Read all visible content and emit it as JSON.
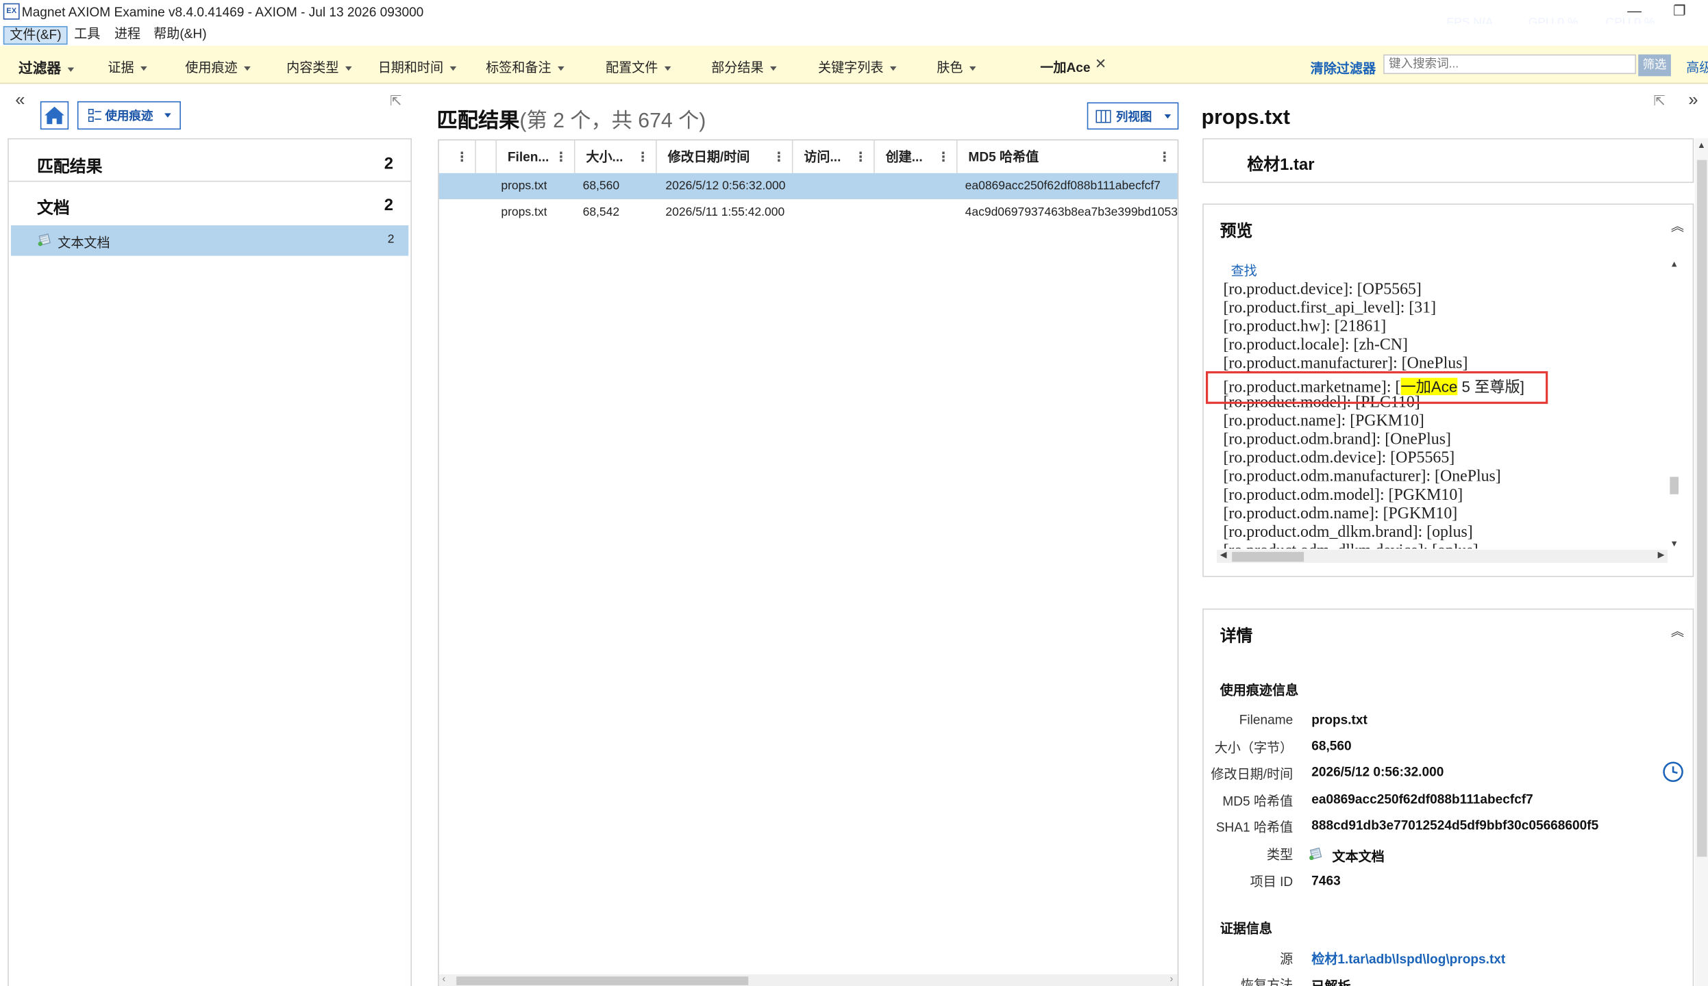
{
  "window": {
    "title": "Magnet AXIOM Examine v8.4.0.41469 - AXIOM - Jul 13 2026 093000",
    "app_icon": "EX",
    "fps_label": "FPS N/A",
    "gpu_label": "GPU 0 %",
    "cpu_label": "CPU 0 %",
    "minimize": "—",
    "restore": "❐"
  },
  "menu": {
    "items": [
      {
        "label": "文件(&F)"
      },
      {
        "label": "工具"
      },
      {
        "label": "进程"
      },
      {
        "label": "帮助(&H)"
      }
    ]
  },
  "filters": {
    "label": "过滤器",
    "items": [
      {
        "label": "证据"
      },
      {
        "label": "使用痕迹"
      },
      {
        "label": "内容类型"
      },
      {
        "label": "日期和时间"
      },
      {
        "label": "标签和备注"
      },
      {
        "label": "配置文件"
      },
      {
        "label": "部分结果"
      },
      {
        "label": "关键字列表"
      },
      {
        "label": "肤色"
      }
    ],
    "active_filter": "一加Ace",
    "clear_label": "清除过滤器",
    "search_placeholder": "键入搜索词...",
    "filter_button": "筛选",
    "advanced_label": "高级"
  },
  "left_panel": {
    "view_button": "使用痕迹",
    "rows": [
      {
        "label": "匹配结果",
        "count": "2"
      },
      {
        "label": "文档",
        "count": "2"
      },
      {
        "label": "文本文档",
        "count": "2"
      }
    ]
  },
  "results": {
    "title": "匹配结果",
    "subtitle": "(第 2 个，共 674 个)",
    "view_button": "列视图",
    "columns": [
      "Filen...",
      "大小...",
      "修改日期/时间",
      "访问...",
      "创建...",
      "MD5 哈希值"
    ],
    "rows": [
      {
        "filename": "props.txt",
        "size": "68,560",
        "modified": "2026/5/12 0:56:32.000",
        "accessed": "",
        "created": "",
        "md5": "ea0869acc250f62df088b111abecfcf7"
      },
      {
        "filename": "props.txt",
        "size": "68,542",
        "modified": "2026/5/11 1:55:42.000",
        "accessed": "",
        "created": "",
        "md5": "4ac9d0697937463b8ea7b3e399bd1053"
      }
    ]
  },
  "detail_panel": {
    "title": "props.txt",
    "evidence": "检材1.tar",
    "preview_heading": "预览",
    "find_link": "查找",
    "preview_lines": [
      "[ro.product.device]: [OP5565]",
      "[ro.product.first_api_level]: [31]",
      "[ro.product.hw]: [21861]",
      "[ro.product.locale]: [zh-CN]",
      "[ro.product.manufacturer]: [OnePlus]",
      "[ro.product.model]: [PLC110]",
      "[ro.product.name]: [PGKM10]",
      "[ro.product.odm.brand]: [OnePlus]",
      "[ro.product.odm.device]: [OP5565]",
      "[ro.product.odm.manufacturer]: [OnePlus]",
      "[ro.product.odm.model]: [PGKM10]",
      "[ro.product.odm.name]: [PGKM10]",
      "[ro.product.odm_dlkm.brand]: [oplus]",
      "[ro.product.odm_dlkm.device]: [oplus]"
    ],
    "highlight_line": {
      "prefix": "[ro.product.marketname]: [",
      "match": "一加Ace",
      "suffix": " 5 至尊版]"
    },
    "details_heading": "详情",
    "artifact_section": "使用痕迹信息",
    "fields": [
      {
        "label": "Filename",
        "value": "props.txt"
      },
      {
        "label": "大小（字节）",
        "value": "68,560"
      },
      {
        "label": "修改日期/时间",
        "value": "2026/5/12 0:56:32.000"
      },
      {
        "label": "MD5 哈希值",
        "value": "ea0869acc250f62df088b111abecfcf7"
      },
      {
        "label": "SHA1 哈希值",
        "value": "888cd91db3e77012524d5df9bbf30c05668600f5"
      },
      {
        "label": "类型",
        "value": "文本文档"
      },
      {
        "label": "项目 ID",
        "value": "7463"
      }
    ],
    "evidence_section": "证据信息",
    "source_label": "源",
    "source_value": "检材1.tar\\adb\\lspd\\log\\props.txt",
    "recovery_label": "恢复方法",
    "recovery_value": "已解析"
  },
  "colors": {
    "filter_bar_bg": "#fffbd6",
    "selection": "#b4d3ec",
    "accent_blue": "#1a63b8",
    "highlight": "#ffff00",
    "annotation_red": "#e53935"
  }
}
